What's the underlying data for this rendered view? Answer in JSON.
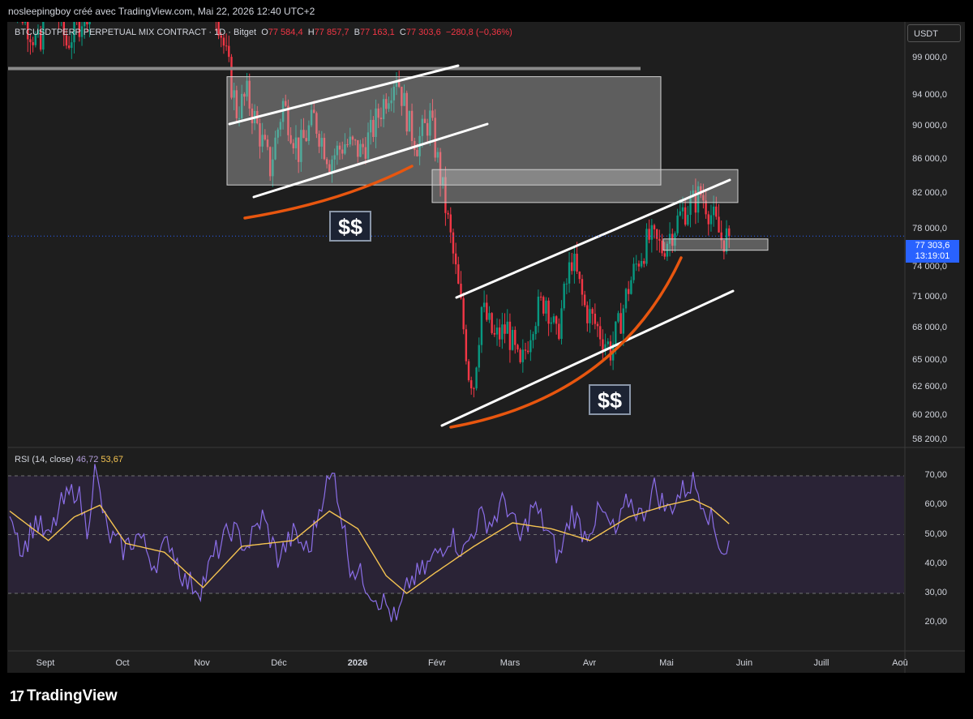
{
  "header": {
    "credit": "nosleepingboy créé avec TradingView.com, Mai 22, 2026 12:40 UTC+2"
  },
  "title": {
    "symbol": "BTCUSDTPERP PERPETUAL MIX CONTRACT · 1D · Bitget",
    "o_label": "O",
    "o_value": "77 584,4",
    "h_label": "H",
    "h_value": "77 857,7",
    "b_label": "B",
    "b_value": "77 163,1",
    "c_label": "C",
    "c_value": "77 303,6",
    "change": "−280,8 (−0,36%)"
  },
  "currency_button": "USDT",
  "price_tag": {
    "price": "77 303,6",
    "countdown": "13:19:01"
  },
  "annotations": {
    "dollar_1": "$$",
    "dollar_2": "$$"
  },
  "rsi_label": {
    "name": "RSI (14, close)",
    "rsi": "46,72",
    "ma": "53,67"
  },
  "brand": {
    "name": "TradingView"
  },
  "colors": {
    "up": "#089981",
    "down": "#f23645",
    "orange": "#e8560f",
    "rsi": "#8b6ee8",
    "rsi_ma": "#f5c451",
    "price_line": "#2962ff"
  },
  "chart_data": [
    {
      "type": "candlestick",
      "title": "BTCUSDTPERP PERPETUAL MIX CONTRACT · 1D · Bitget",
      "x_ticks": [
        "Sept",
        "Oct",
        "Nov",
        "Déc",
        "2026",
        "Févr",
        "Mars",
        "Avr",
        "Mai",
        "Juin",
        "Juill",
        "Aoû"
      ],
      "y_ticks": [
        "58 200,0",
        "60 200,0",
        "62 600,0",
        "65 000,0",
        "68 000,0",
        "71 000,0",
        "74 000,0",
        "78 000,0",
        "82 000,0",
        "86 000,0",
        "90 000,0",
        "94 000,0",
        "99 000,0"
      ],
      "scale": "log",
      "ylim": [
        58200,
        108000
      ],
      "last_price": 77303.6,
      "ohlc_anchor_closes": [
        [
          0,
          109000
        ],
        [
          12,
          100000
        ],
        [
          14,
          111000
        ],
        [
          22,
          101000
        ],
        [
          36,
          110000
        ],
        [
          50,
          114000
        ],
        [
          63,
          116000
        ],
        [
          72,
          113000
        ],
        [
          79,
          108000
        ],
        [
          84,
          99000
        ],
        [
          88,
          92000
        ],
        [
          92,
          94000
        ],
        [
          96,
          90000
        ],
        [
          101,
          85000
        ],
        [
          106,
          93000
        ],
        [
          112,
          87000
        ],
        [
          118,
          91000
        ],
        [
          124,
          86000
        ],
        [
          130,
          88000
        ],
        [
          136,
          87000
        ],
        [
          140,
          89000
        ],
        [
          146,
          94000
        ],
        [
          150,
          97000
        ],
        [
          155,
          90000
        ],
        [
          158,
          88000
        ],
        [
          163,
          91000
        ],
        [
          167,
          84000
        ],
        [
          171,
          77000
        ],
        [
          175,
          70000
        ],
        [
          178,
          64000
        ],
        [
          180,
          63000
        ],
        [
          183,
          70000
        ],
        [
          188,
          67000
        ],
        [
          193,
          68000
        ],
        [
          198,
          64000
        ],
        [
          203,
          69000
        ],
        [
          208,
          71000
        ],
        [
          212,
          67000
        ],
        [
          218,
          75000
        ],
        [
          223,
          70000
        ],
        [
          228,
          68000
        ],
        [
          233,
          66000
        ],
        [
          236,
          68000
        ],
        [
          240,
          72000
        ],
        [
          244,
          75000
        ],
        [
          248,
          77000
        ],
        [
          253,
          76000
        ],
        [
          257,
          78000
        ],
        [
          261,
          80000
        ],
        [
          265,
          81000
        ],
        [
          268,
          82000
        ],
        [
          270,
          81000
        ],
        [
          273,
          79000
        ],
        [
          276,
          77000
        ],
        [
          279,
          77300
        ]
      ],
      "annotations": [
        {
          "type": "zone",
          "from_date": "Nov",
          "to_date": "Mai",
          "price_low": 83000,
          "price_high": 96500
        },
        {
          "type": "zone",
          "from_date": "Févr",
          "to_date": "Mai",
          "price_low": 81000,
          "price_high": 84800
        },
        {
          "type": "zone",
          "from_date": "Mai",
          "to_date": "Juin",
          "price_low": 75800,
          "price_high": 77000
        },
        {
          "type": "hline",
          "price": 97600
        },
        {
          "type": "label",
          "text": "$$"
        },
        {
          "type": "label",
          "text": "$$"
        }
      ]
    },
    {
      "type": "line",
      "title": "RSI (14, close)",
      "y_ticks": [
        "20,00",
        "30,00",
        "40,00",
        "50,00",
        "60,00",
        "70,00"
      ],
      "ylim": [
        12,
        76
      ],
      "levels": [
        70,
        50,
        30
      ],
      "series": [
        {
          "name": "RSI",
          "anchors": [
            [
              0,
              60
            ],
            [
              5,
              44
            ],
            [
              10,
              55
            ],
            [
              15,
              48
            ],
            [
              20,
              60
            ],
            [
              26,
              66
            ],
            [
              30,
              52
            ],
            [
              33,
              72
            ],
            [
              38,
              50
            ],
            [
              44,
              45
            ],
            [
              50,
              50
            ],
            [
              56,
              40
            ],
            [
              62,
              48
            ],
            [
              68,
              34
            ],
            [
              74,
              32
            ],
            [
              80,
              44
            ],
            [
              86,
              52
            ],
            [
              92,
              46
            ],
            [
              98,
              56
            ],
            [
              104,
              42
            ],
            [
              110,
              50
            ],
            [
              116,
              44
            ],
            [
              122,
              66
            ],
            [
              126,
              70
            ],
            [
              132,
              40
            ],
            [
              137,
              35
            ],
            [
              141,
              30
            ],
            [
              146,
              26
            ],
            [
              150,
              20
            ],
            [
              155,
              34
            ],
            [
              161,
              38
            ],
            [
              166,
              44
            ],
            [
              171,
              50
            ],
            [
              176,
              44
            ],
            [
              182,
              56
            ],
            [
              187,
              54
            ],
            [
              192,
              62
            ],
            [
              198,
              48
            ],
            [
              203,
              60
            ],
            [
              208,
              52
            ],
            [
              213,
              42
            ],
            [
              218,
              58
            ],
            [
              223,
              50
            ],
            [
              229,
              58
            ],
            [
              235,
              50
            ],
            [
              240,
              62
            ],
            [
              245,
              56
            ],
            [
              250,
              66
            ],
            [
              255,
              58
            ],
            [
              260,
              64
            ],
            [
              265,
              68
            ],
            [
              270,
              60
            ],
            [
              274,
              50
            ],
            [
              277,
              44
            ],
            [
              279,
              46.72
            ]
          ]
        },
        {
          "name": "RSI MA",
          "anchors": [
            [
              0,
              58
            ],
            [
              15,
              48
            ],
            [
              25,
              56
            ],
            [
              35,
              60
            ],
            [
              45,
              47
            ],
            [
              60,
              44
            ],
            [
              75,
              32
            ],
            [
              90,
              46
            ],
            [
              110,
              48
            ],
            [
              124,
              58
            ],
            [
              135,
              52
            ],
            [
              146,
              36
            ],
            [
              154,
              30
            ],
            [
              165,
              37
            ],
            [
              180,
              46
            ],
            [
              195,
              54
            ],
            [
              210,
              52
            ],
            [
              225,
              48
            ],
            [
              240,
              56
            ],
            [
              255,
              60
            ],
            [
              265,
              62
            ],
            [
              272,
              59
            ],
            [
              279,
              53.67
            ]
          ]
        }
      ]
    }
  ]
}
